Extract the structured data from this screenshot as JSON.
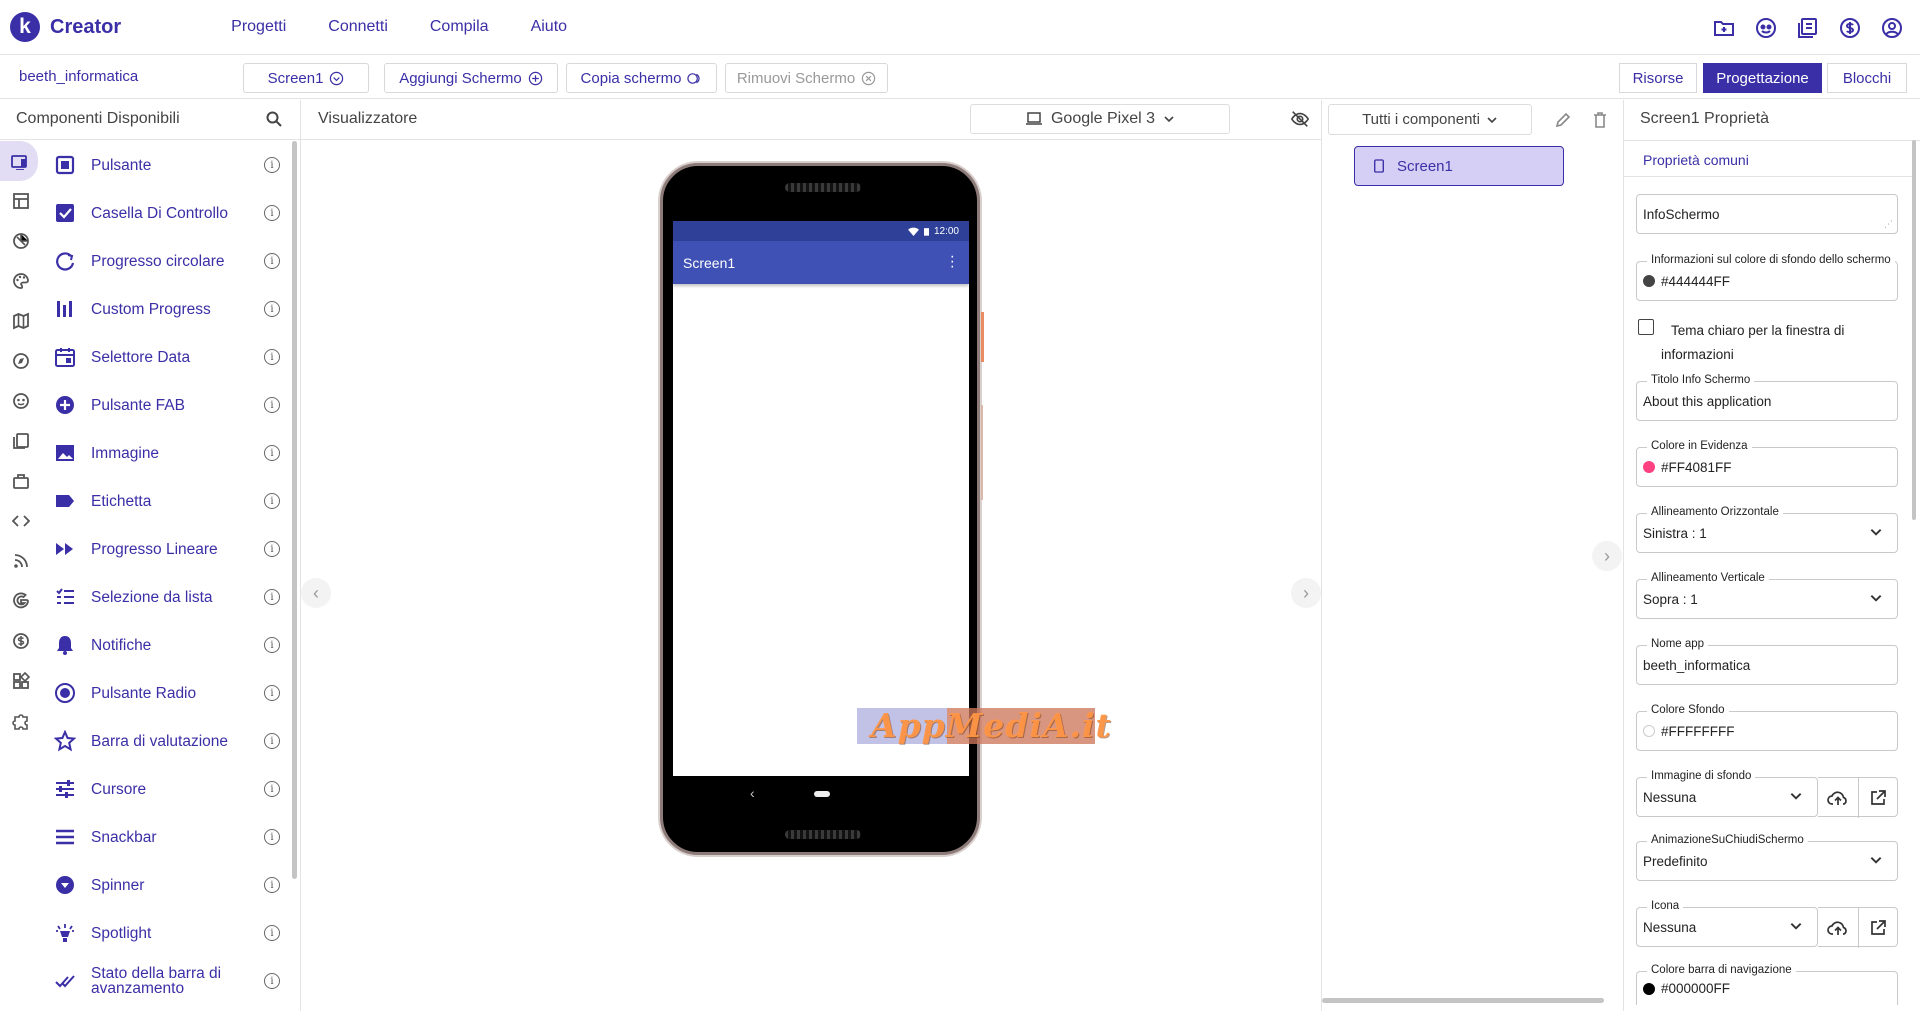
{
  "app": {
    "logo_letter": "k",
    "name": "Creator"
  },
  "topmenu": [
    "Progetti",
    "Connetti",
    "Compila",
    "Aiuto"
  ],
  "topicons": [
    "folder-icon",
    "gallery-icon",
    "guide-icon",
    "donate-icon",
    "account-icon"
  ],
  "project": {
    "name": "beeth_informatica"
  },
  "screen_bar": {
    "screen_select": "Screen1",
    "add_screen": "Aggiungi Schermo",
    "copy_screen": "Copia schermo",
    "remove_screen": "Rimuovi Schermo"
  },
  "right_tabs": {
    "resources": "Risorse",
    "design": "Progettazione",
    "blocks": "Blocchi"
  },
  "palette": {
    "title": "Componenti Disponibili",
    "categories": [
      "user-interface-icon",
      "layout-icon",
      "media-icon",
      "drawing-icon",
      "maps-icon",
      "sensors-icon",
      "social-icon",
      "storage-icon",
      "connectivity-icon",
      "code-icon",
      "feed-icon",
      "google-icon",
      "monetization-icon",
      "widgets-icon",
      "extensions-icon"
    ],
    "items": [
      {
        "label": "Pulsante",
        "icon": "button-icon"
      },
      {
        "label": "Casella Di Controllo",
        "icon": "checkbox-icon"
      },
      {
        "label": "Progresso circolare",
        "icon": "circular-progress-icon"
      },
      {
        "label": "Custom Progress",
        "icon": "custom-progress-icon"
      },
      {
        "label": "Selettore Data",
        "icon": "date-picker-icon"
      },
      {
        "label": "Pulsante FAB",
        "icon": "fab-icon"
      },
      {
        "label": "Immagine",
        "icon": "image-icon"
      },
      {
        "label": "Etichetta",
        "icon": "label-icon"
      },
      {
        "label": "Progresso Lineare",
        "icon": "linear-progress-icon"
      },
      {
        "label": "Selezione da lista",
        "icon": "list-picker-icon"
      },
      {
        "label": "Notifiche",
        "icon": "notifier-icon"
      },
      {
        "label": "Pulsante Radio",
        "icon": "radio-icon"
      },
      {
        "label": "Barra di valutazione",
        "icon": "rating-icon"
      },
      {
        "label": "Cursore",
        "icon": "slider-icon"
      },
      {
        "label": "Snackbar",
        "icon": "snackbar-icon"
      },
      {
        "label": "Spinner",
        "icon": "spinner-icon"
      },
      {
        "label": "Spotlight",
        "icon": "spotlight-icon"
      },
      {
        "label": "Stato della barra di avanzamento",
        "icon": "progress-state-icon"
      }
    ],
    "info_glyph": "i"
  },
  "viewer": {
    "title": "Visualizzatore",
    "device": "Google Pixel 3",
    "phone": {
      "time": "12:00",
      "screen_title": "Screen1"
    },
    "watermark": "AppMediA.it"
  },
  "tree": {
    "filter": "Tutti i componenti",
    "root": "Screen1"
  },
  "properties": {
    "title": "Screen1 Proprietà",
    "tab": "Proprietà comuni",
    "about": "InfoSchermo",
    "about_bg_label": "Informazioni sul colore di sfondo dello schermo",
    "about_bg_value": "#444444FF",
    "light_theme_label": "Tema chiaro per la finestra di informazioni",
    "about_title_label": "Titolo Info Schermo",
    "about_title_value": "About this application",
    "accent_label": "Colore in Evidenza",
    "accent_value": "#FF4081FF",
    "halign_label": "Allineamento Orizzontale",
    "halign_value": "Sinistra : 1",
    "valign_label": "Allineamento Verticale",
    "valign_value": "Sopra : 1",
    "appname_label": "Nome app",
    "appname_value": "beeth_informatica",
    "bg_label": "Colore Sfondo",
    "bg_value": "#FFFFFFFF",
    "bgimg_label": "Immagine di sfondo",
    "bgimg_value": "Nessuna",
    "close_anim_label": "AnimazioneSuChiudiSchermo",
    "close_anim_value": "Predefinito",
    "icon_label": "Icona",
    "icon_value": "Nessuna",
    "navbar_color_label": "Colore barra di navigazione",
    "navbar_color_value": "#000000FF"
  },
  "colors": {
    "brand": "#3A2FA6",
    "about_bg": "#444444",
    "accent": "#FF4081",
    "bg": "#FFFFFF",
    "navbar": "#000000",
    "app_bar": "#3F51B5"
  }
}
